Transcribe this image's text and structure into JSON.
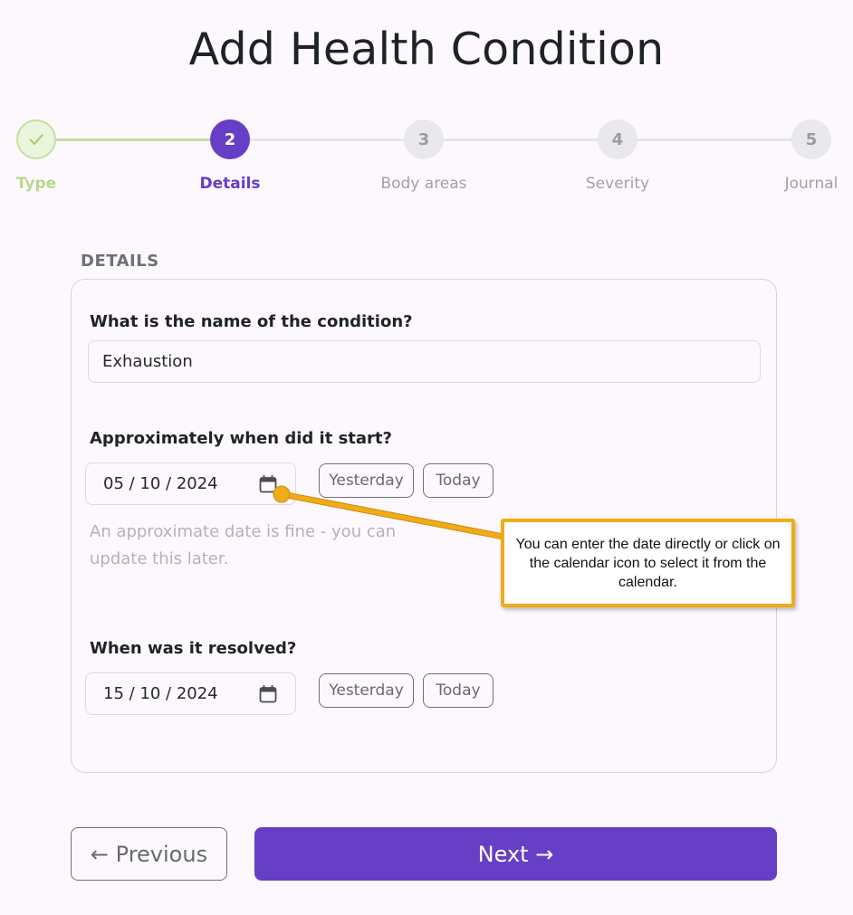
{
  "page": {
    "title": "Add Health Condition"
  },
  "stepper": {
    "steps": [
      {
        "number": "",
        "label": "Type",
        "state": "completed",
        "icon": "check-icon"
      },
      {
        "number": "2",
        "label": "Details",
        "state": "active"
      },
      {
        "number": "3",
        "label": "Body areas",
        "state": "upcoming"
      },
      {
        "number": "4",
        "label": "Severity",
        "state": "upcoming"
      },
      {
        "number": "5",
        "label": "Journal",
        "state": "upcoming"
      }
    ]
  },
  "details": {
    "section_title": "DETAILS",
    "condition_name": {
      "label": "What is the name of the condition?",
      "value": "Exhaustion"
    },
    "start_date": {
      "label": "Approximately when did it start?",
      "value": "05 / 10 / 2024",
      "help": "An approximate date is fine - you can update this later.",
      "yesterday_label": "Yesterday",
      "today_label": "Today"
    },
    "resolved_date": {
      "label": "When was it resolved?",
      "value": "15 / 10 / 2024",
      "yesterday_label": "Yesterday",
      "today_label": "Today"
    }
  },
  "callout": {
    "text": "You can enter the date directly or click on the calendar icon to select it from the calendar."
  },
  "footer": {
    "previous_label": "← Previous",
    "next_label": "Next →"
  },
  "colors": {
    "accent": "#673ec6",
    "completed": "#c4df9d",
    "callout_border": "#f0ab17"
  }
}
